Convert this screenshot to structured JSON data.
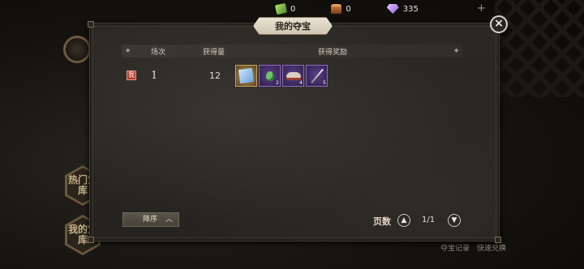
{
  "currencies": [
    {
      "icon": "green-gem-icon",
      "value": "0"
    },
    {
      "icon": "treasure-chest-icon",
      "value": "0"
    },
    {
      "icon": "diamond-icon",
      "value": "335"
    }
  ],
  "panel": {
    "title": "我的夺宝",
    "close_symbol": "×",
    "columns": {
      "round": "场次",
      "amount": "获得量",
      "rewards": "获得奖励"
    },
    "rows": [
      {
        "tag": "我",
        "round": "1",
        "amount": "12",
        "rewards": [
          {
            "icon": "treasure-map-icon",
            "qty": ""
          },
          {
            "icon": "green-potion-icon",
            "qty": "2"
          },
          {
            "icon": "boots-icon",
            "qty": "4"
          },
          {
            "icon": "sword-icon",
            "qty": "5"
          }
        ]
      }
    ],
    "sort_label": "降序",
    "page_label": "页数",
    "page_value": "1/1"
  },
  "background": {
    "side_buttons": [
      "热门宝库",
      "我的宝库"
    ],
    "bottom_links": [
      "夺宝记录",
      "快速兑换"
    ]
  }
}
